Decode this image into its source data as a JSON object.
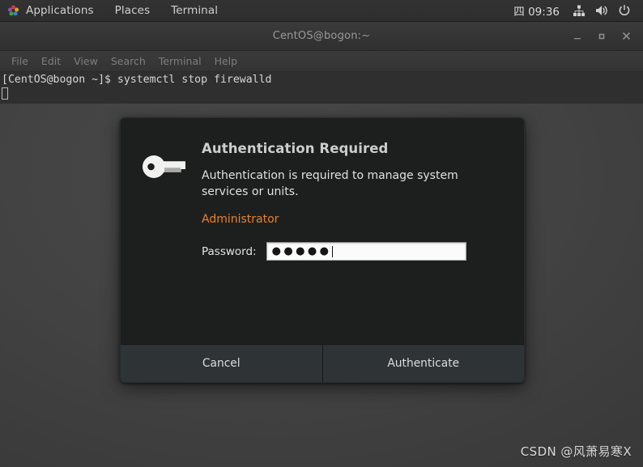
{
  "top_panel": {
    "logo_icon": "gnome-footprint-icon",
    "items": [
      {
        "label": "Applications"
      },
      {
        "label": "Places"
      },
      {
        "label": "Terminal"
      }
    ],
    "clock": "四 09:36",
    "tray": [
      {
        "icon": "network-wired-icon"
      },
      {
        "icon": "volume-icon"
      },
      {
        "icon": "power-icon"
      }
    ]
  },
  "terminal": {
    "title": "CentOS@bogon:~",
    "window_controls": {
      "minimize": "minimize-icon",
      "maximize": "maximize-icon",
      "close": "close-icon"
    },
    "menu": [
      {
        "label": "File"
      },
      {
        "label": "Edit"
      },
      {
        "label": "View"
      },
      {
        "label": "Search"
      },
      {
        "label": "Terminal"
      },
      {
        "label": "Help"
      }
    ],
    "lines": [
      "[CentOS@bogon ~]$ systemctl stop firewalld"
    ]
  },
  "auth_dialog": {
    "icon": "key-icon",
    "title": "Authentication Required",
    "message": "Authentication is required to manage system services or units.",
    "user": "Administrator",
    "user_color": "#e8822a",
    "password_label": "Password:",
    "password_value": "●●●●●",
    "password_placeholder": "",
    "buttons": {
      "cancel": "Cancel",
      "authenticate": "Authenticate"
    }
  },
  "watermark": {
    "text": "CSDN @风萧易寒X"
  }
}
